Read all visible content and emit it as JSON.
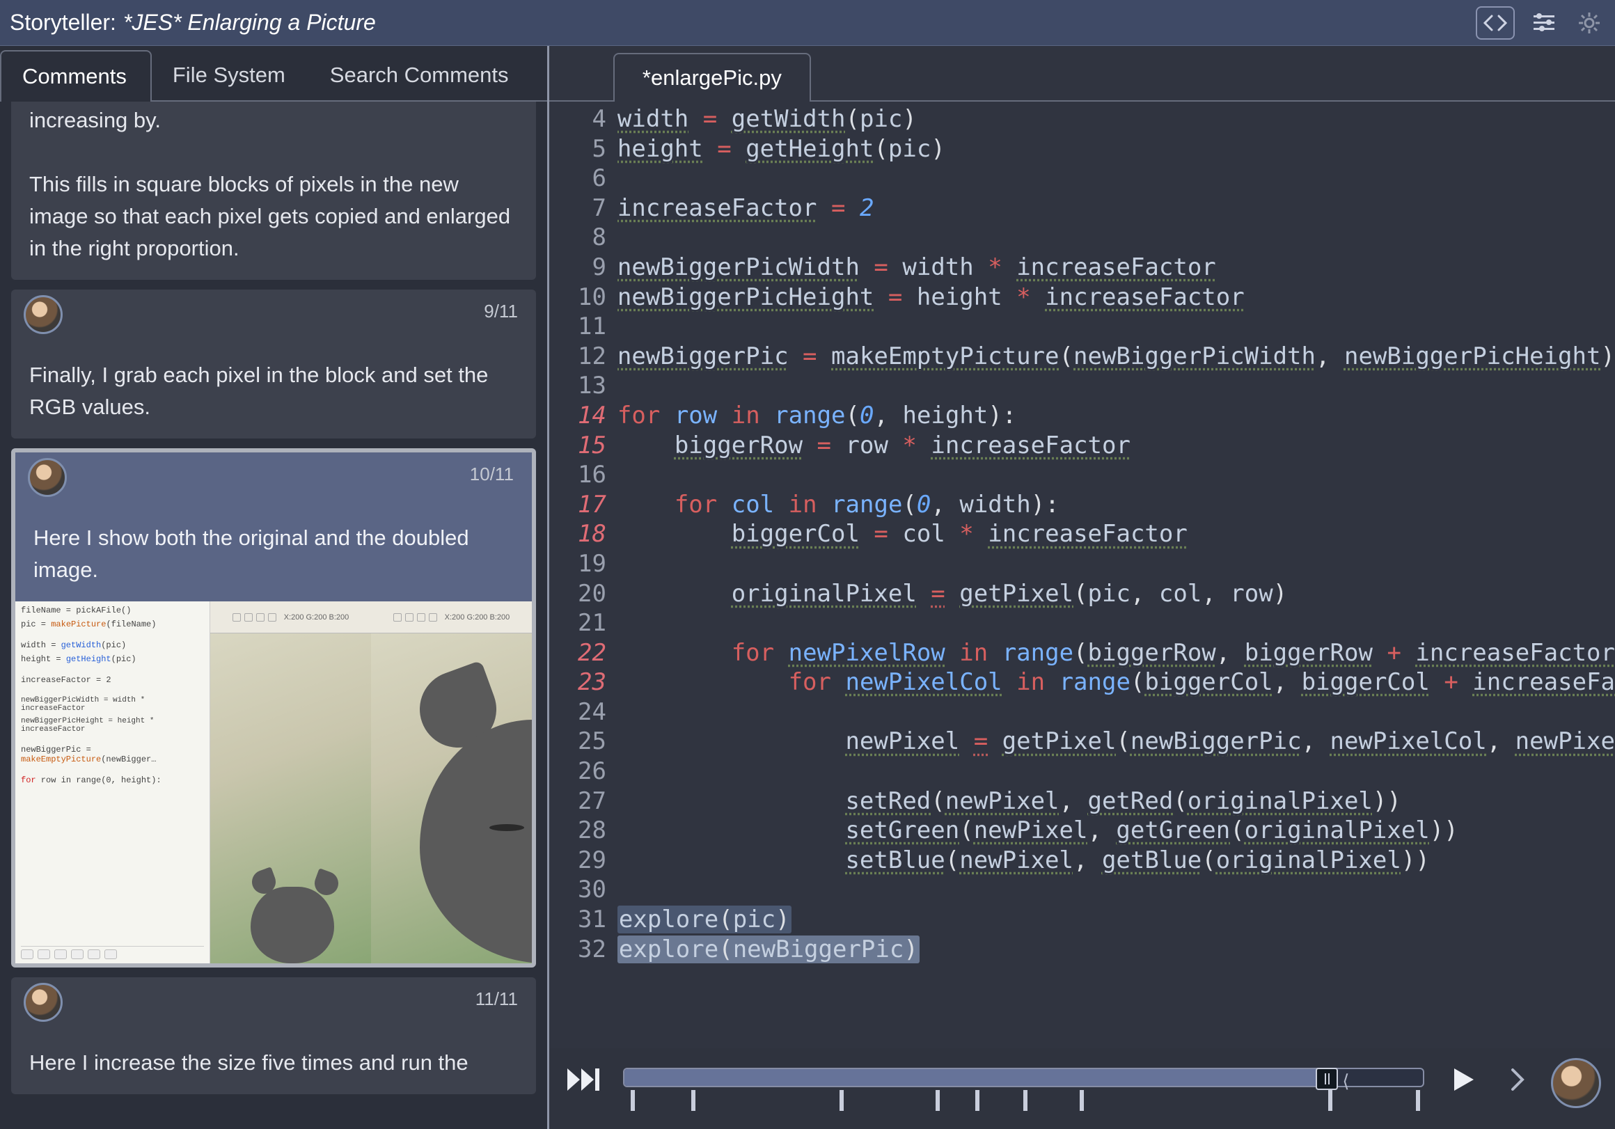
{
  "titlebar": {
    "app": "Storyteller:",
    "doc": "*JES* Enlarging a Picture"
  },
  "left_tabs": [
    "Comments",
    "File System",
    "Search Comments"
  ],
  "comments": {
    "partial_prev": "increasing by.\n\nThis fills in square blocks of pixels in the new image so that each pixel gets copied and enlarged in the right proportion.",
    "c9": {
      "counter": "9/11",
      "body": "Finally, I grab each pixel in the block and set the RGB values."
    },
    "c10": {
      "counter": "10/11",
      "body": "Here I show both the original and the doubled image."
    },
    "c11": {
      "counter": "11/11",
      "body": "Here I increase the size five times and run the"
    }
  },
  "thumbnail_code": {
    "l1": "fileName = pickAFile()",
    "l2": "pic = makePicture(fileName)",
    "l3": "width = getWidth(pic)",
    "l4": "height = getHeight(pic)",
    "l5": "increaseFactor = 2",
    "l6": "newBiggerPicWidth = width * increaseFactor",
    "l7": "newBiggerPicHeight = height * increaseFactor",
    "l8": "newBiggerPic = makeEmptyPicture(newBigger...)",
    "l9": "for row in range(0, height):"
  },
  "editor": {
    "tab": "*enlargePic.py",
    "lines": {
      "4": {
        "n": "4",
        "hi": false,
        "txt": "width = getWidth(pic)"
      },
      "5": {
        "n": "5",
        "hi": false
      },
      "6": {
        "n": "6",
        "hi": false
      },
      "7": {
        "n": "7",
        "hi": false
      },
      "8": {
        "n": "8",
        "hi": false
      },
      "9": {
        "n": "9",
        "hi": false
      },
      "10": {
        "n": "10",
        "hi": false
      },
      "11": {
        "n": "11",
        "hi": false
      },
      "12": {
        "n": "12",
        "hi": false
      },
      "13": {
        "n": "13",
        "hi": false
      },
      "14": {
        "n": "14",
        "hi": true
      },
      "15": {
        "n": "15",
        "hi": true
      },
      "16": {
        "n": "16",
        "hi": false
      },
      "17": {
        "n": "17",
        "hi": true
      },
      "18": {
        "n": "18",
        "hi": true
      },
      "19": {
        "n": "19",
        "hi": false
      },
      "20": {
        "n": "20",
        "hi": false
      },
      "21": {
        "n": "21",
        "hi": false
      },
      "22": {
        "n": "22",
        "hi": true
      },
      "23": {
        "n": "23",
        "hi": true
      },
      "24": {
        "n": "24",
        "hi": false
      },
      "25": {
        "n": "25",
        "hi": false
      },
      "26": {
        "n": "26",
        "hi": false
      },
      "27": {
        "n": "27",
        "hi": false
      },
      "28": {
        "n": "28",
        "hi": false
      },
      "29": {
        "n": "29",
        "hi": false
      },
      "30": {
        "n": "30",
        "hi": false
      },
      "31": {
        "n": "31",
        "hi": false
      },
      "32": {
        "n": "32",
        "hi": false
      }
    },
    "tokens": {
      "width": "width",
      "eq": "=",
      "getWidth": "getWidth",
      "pic": "pic",
      "height": "height",
      "getHeight": "getHeight",
      "increaseFactor": "increaseFactor",
      "two": "2",
      "newBiggerPicWidth": "newBiggerPicWidth",
      "star": "*",
      "newBiggerPicHeight": "newBiggerPicHeight",
      "newBiggerPic": "newBiggerPic",
      "makeEmptyPicture": "makeEmptyPicture",
      "for": "for",
      "row": "row",
      "in": "in",
      "range": "range",
      "zero": "0",
      "comma": ",",
      "col": "col",
      "biggerRow": "biggerRow",
      "biggerCol": "biggerCol",
      "originalPixel": "originalPixel",
      "getPixel": "getPixel",
      "newPixelRow": "newPixelRow",
      "plus": "+",
      "newPixelCol": "newPixelCol",
      "newPixel": "newPixel",
      "setRed": "setRed",
      "getRed": "getRed",
      "setGreen": "setGreen",
      "getGreen": "getGreen",
      "setBlue": "setBlue",
      "getBlue": "getBlue",
      "explore": "explore",
      "lp": "(",
      "rp": ")",
      "colon": ":",
      "newPixe": "newPixe",
      "increaseFa": "increaseFa",
      "increaseFactor_cut": "increaseFactor"
    }
  },
  "playback": {
    "progress_pct": 88,
    "ticks_pct": [
      1,
      8.5,
      27,
      39,
      44,
      50,
      57,
      88,
      99
    ]
  }
}
